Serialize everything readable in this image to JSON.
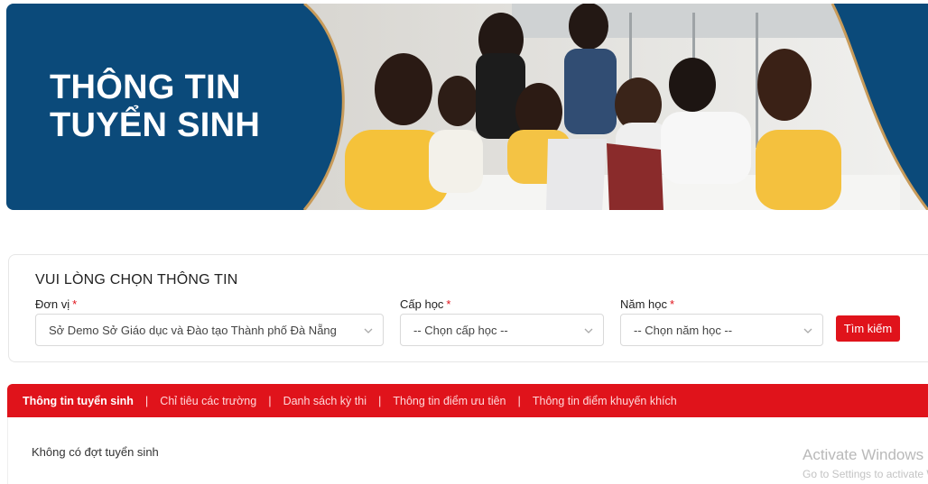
{
  "banner": {
    "title_line1": "THÔNG TIN",
    "title_line2": "TUYỂN SINH",
    "primary_color": "#0b4a7a"
  },
  "filter": {
    "title": "VUI LÒNG CHỌN THÔNG TIN",
    "unit_label": "Đơn vị",
    "unit_value": "Sở Demo Sở Giáo dục và Đào tạo Thành phố Đà Nẵng",
    "level_label": "Cấp học",
    "level_value": "-- Chọn cấp học --",
    "year_label": "Năm học",
    "year_value": "-- Chọn năm học --",
    "required_mark": "*",
    "search_button": "Tìm kiếm"
  },
  "tabs": [
    {
      "label": "Thông tin tuyển sinh",
      "active": true
    },
    {
      "label": "Chỉ tiêu các trường",
      "active": false
    },
    {
      "label": "Danh sách kỳ thi",
      "active": false
    },
    {
      "label": "Thông tin điểm ưu tiên",
      "active": false
    },
    {
      "label": "Thông tin điểm khuyến khích",
      "active": false
    }
  ],
  "tab_separator": "|",
  "content": {
    "empty_message": "Không có đợt tuyển sinh"
  },
  "watermark": {
    "line1": "Activate Windows",
    "line2": "Go to Settings to activate Windows."
  },
  "colors": {
    "accent_red": "#e0131b",
    "banner_blue": "#0b4a7a"
  }
}
